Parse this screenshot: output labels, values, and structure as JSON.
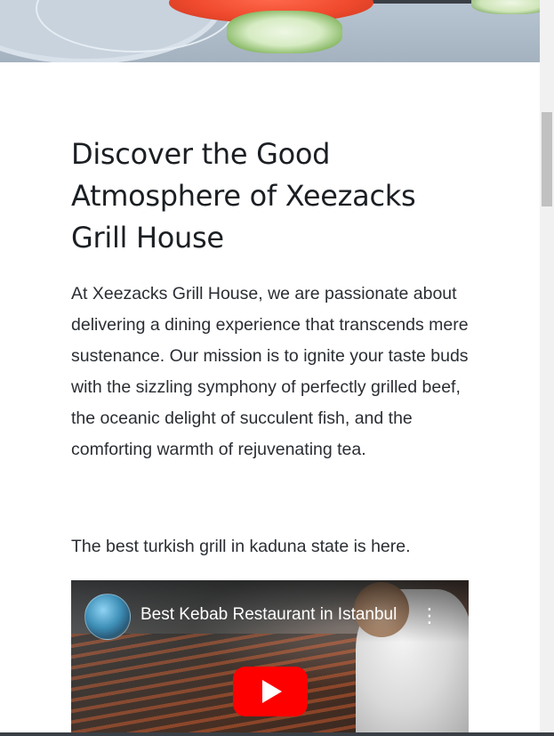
{
  "article": {
    "heading_line1": "Discover the Good",
    "heading_line2": "Atmosphere of Xeezacks",
    "heading_line3": "Grill House",
    "body": "At Xeezacks Grill House, we are passionate about delivering a dining experience that transcends mere sustenance. Our mission is to ignite your taste buds with the sizzling symphony of perfectly grilled beef, the oceanic delight of succulent fish, and the comforting warmth of rejuvenating tea.",
    "tagline": "The best turkish grill in kaduna state is here."
  },
  "video": {
    "title": "Best Kebab Restaurant in Istanbul",
    "icons": {
      "avatar": "channel-avatar",
      "menu": "more-vert-icon",
      "play": "youtube-play-icon"
    },
    "colors": {
      "play_button": "#ff0000"
    }
  }
}
